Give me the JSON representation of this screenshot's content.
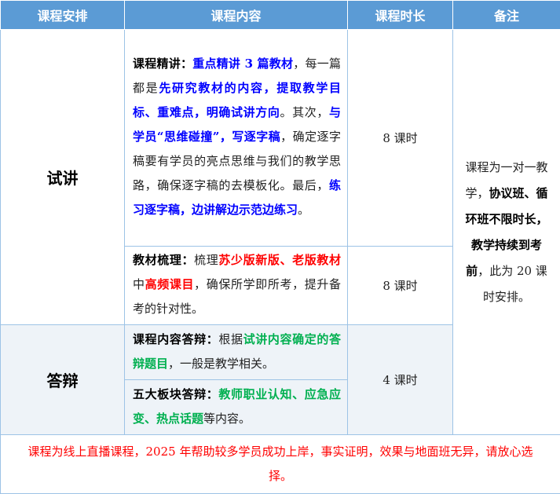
{
  "headers": [
    "课程安排",
    "课程内容",
    "课程时长",
    "备注"
  ],
  "sections": {
    "trial": "试讲",
    "defense": "答辩"
  },
  "rows": {
    "r1": {
      "label": "课程精讲：",
      "t1": "重点精讲 3 篇教材",
      "t2": "，每一篇都是",
      "t3": "先研究教材的内容，提取教学目标、重难点，明确试讲方向",
      "t4": "。其次，",
      "t5": "与学员“思维碰撞”，写逐字稿",
      "t6": "，确定逐字稿要有学员的亮点思维与我们的教学思路，确保逐字稿的去模板化。最后，",
      "t7": "练习逐字稿，边讲解边示范边练习",
      "t8": "。",
      "duration": "8 课时"
    },
    "r2": {
      "label": "教材梳理：",
      "t1": "梳理",
      "t2": "苏少版新版、老版教材",
      "t3": "中",
      "t4": "高频课目",
      "t5": "，确保所学即所考，提升备考的针对性。",
      "duration": "8 课时"
    },
    "r3": {
      "label": "课程内容答辩：",
      "t1": "根据",
      "t2": "试讲内容确定的答辩题目",
      "t3": "，一般是教学相关。"
    },
    "r4": {
      "label": "五大板块答辩：",
      "t1": "教师职业认知、应急应变、热点话题",
      "t2": "等内容。",
      "duration": "4 课时"
    }
  },
  "note": {
    "n1": "课程为一对一教学，",
    "n2": "协议班、循环班不限时长，教学持续到考前",
    "n3": "，此为 20 课时安排。"
  },
  "footer": "课程为线上直播课程，2025 年帮助较多学员成功上岸，事实证明，效果与地面班无异，请放心选择。",
  "colors": {
    "header_bg": "#5b9bd5",
    "border": "#9dc3e6",
    "shade": "#eef3f8",
    "blue": "#0000ff",
    "red": "#ff0000",
    "green": "#00b050"
  }
}
